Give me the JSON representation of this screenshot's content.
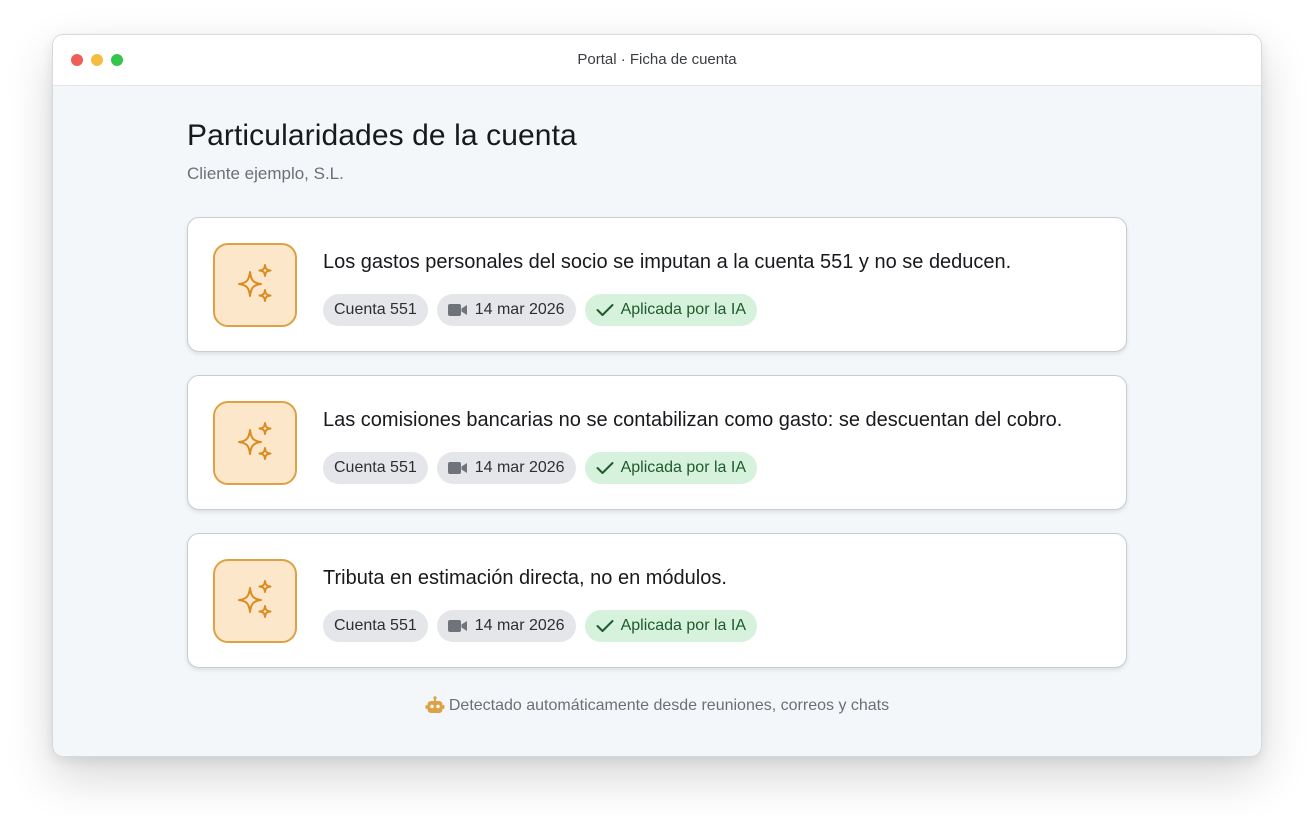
{
  "window": {
    "title": "Portal · Ficha de cuenta"
  },
  "page": {
    "title": "Particularidades de la cuenta",
    "subtitle": "Cliente ejemplo, S.L."
  },
  "items": [
    {
      "text": "Los gastos personales del socio se imputan a la cuenta 551 y no se deducen.",
      "account_tag": "Cuenta 551",
      "date_tag": "14 mar 2026",
      "status_tag": "Aplicada por la IA"
    },
    {
      "text": "Las comisiones bancarias no se contabilizan como gasto: se descuentan del cobro.",
      "account_tag": "Cuenta 551",
      "date_tag": "14 mar 2026",
      "status_tag": "Aplicada por la IA"
    },
    {
      "text": "Tributa en estimación directa, no en módulos.",
      "account_tag": "Cuenta 551",
      "date_tag": "14 mar 2026",
      "status_tag": "Aplicada por la IA"
    }
  ],
  "footer": {
    "text": "Detectado automáticamente desde reuniones, correos y chats"
  },
  "icons": {
    "card_icon": "sparkles-icon",
    "date_icon": "video-camera-icon",
    "status_icon": "check-icon",
    "footer_icon": "robot-icon"
  },
  "colors": {
    "accent": "#e0a044",
    "accent_bg": "#fde7cb",
    "applied_bg": "#d6f2dc",
    "applied_text": "#1e5a2c"
  }
}
